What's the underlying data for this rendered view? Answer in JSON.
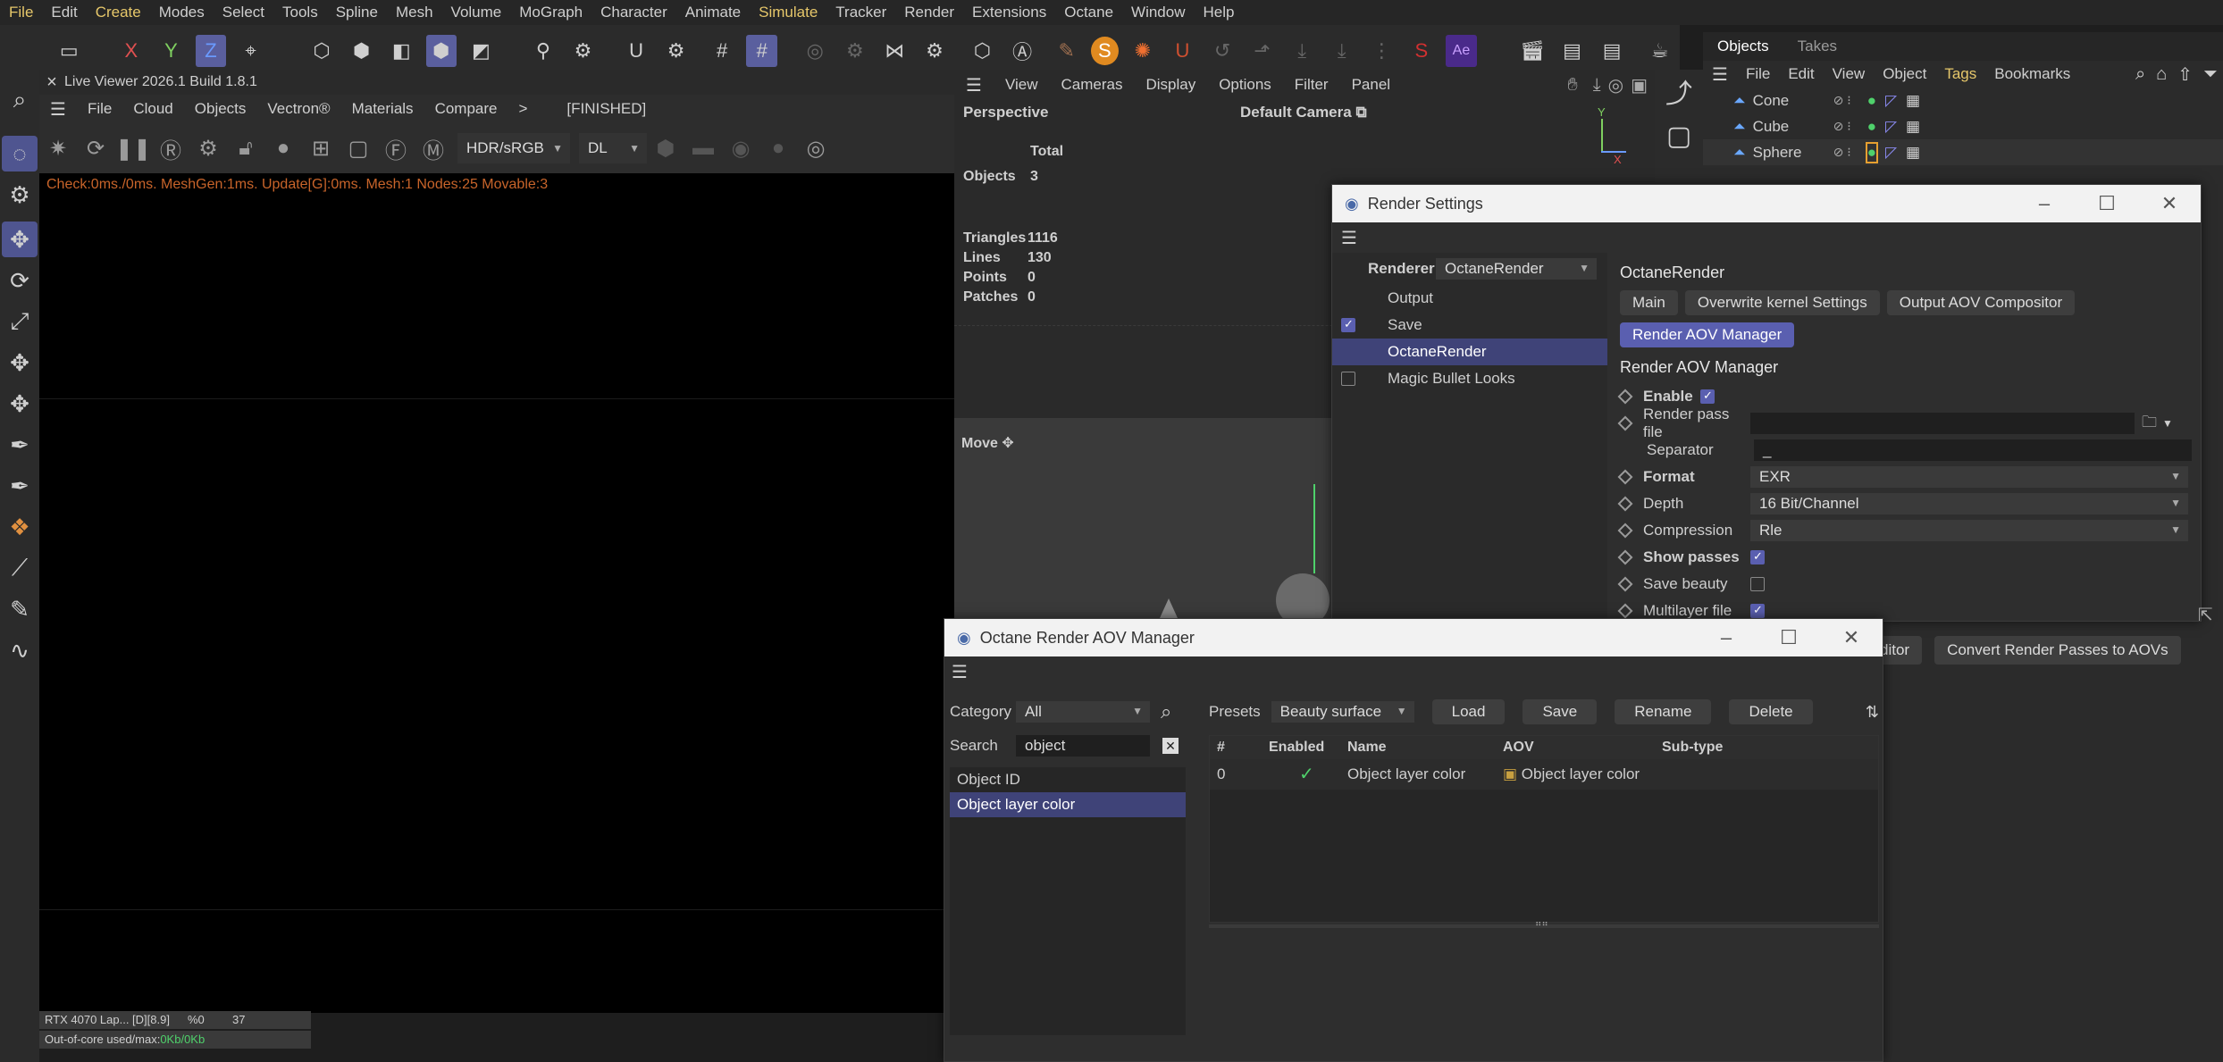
{
  "menubar": [
    "File",
    "Edit",
    "Create",
    "Modes",
    "Select",
    "Tools",
    "Spline",
    "Mesh",
    "Volume",
    "MoGraph",
    "Character",
    "Animate",
    "Simulate",
    "Tracker",
    "Render",
    "Extensions",
    "Octane",
    "Window",
    "Help"
  ],
  "menubar_active": [
    "Create",
    "Simulate"
  ],
  "toolbar_axes": {
    "x": "X",
    "y": "Y",
    "z": "Z"
  },
  "live_viewer": {
    "title": "Live Viewer 2026.1 Build 1.8.1",
    "menu": [
      "File",
      "Cloud",
      "Objects",
      "Vectron®",
      "Materials",
      "Compare",
      ">",
      "[FINISHED]"
    ],
    "color_mode": "HDR/sRGB",
    "kernel": "DL",
    "status": "Check:0ms./0ms. MeshGen:1ms. Update[G]:0ms. Mesh:1 Nodes:25 Movable:3",
    "hud": {
      "gpu": "RTX 4070 Lap... [D][8.9]",
      "pct": "%0",
      "temp": "37",
      "ooc_label": "Out-of-core used/max:",
      "ooc_value": "0Kb/0Kb"
    }
  },
  "viewport": {
    "menu": [
      "View",
      "Cameras",
      "Display",
      "Options",
      "Filter",
      "Panel"
    ],
    "name": "Perspective",
    "camera": "Default Camera",
    "stats": {
      "total_label": "Total",
      "objects_label": "Objects",
      "objects": "3",
      "triangles_label": "Triangles",
      "triangles": "1116",
      "lines_label": "Lines",
      "lines": "130",
      "points_label": "Points",
      "points": "0",
      "patches_label": "Patches",
      "patches": "0"
    },
    "move_label": "Move"
  },
  "objects_panel": {
    "tabs": [
      "Objects",
      "Takes"
    ],
    "menu": [
      "File",
      "Edit",
      "View",
      "Object",
      "Tags",
      "Bookmarks"
    ],
    "items": [
      "Cone",
      "Cube",
      "Sphere"
    ]
  },
  "render_settings": {
    "title": "Render Settings",
    "renderer_label": "Renderer",
    "renderer": "OctaneRender",
    "nav": [
      "Output",
      "Save",
      "OctaneRender",
      "Magic Bullet Looks"
    ],
    "section": "OctaneRender",
    "tabs": [
      "Main",
      "Overwrite kernel Settings",
      "Output AOV Compositor",
      "Render AOV Manager"
    ],
    "heading": "Render AOV Manager",
    "fields": {
      "enable": "Enable",
      "render_pass_file": "Render pass file",
      "separator": "Separator",
      "separator_value": "_",
      "format": "Format",
      "format_value": "EXR",
      "depth": "Depth",
      "depth_value": "16 Bit/Channel",
      "compression": "Compression",
      "compression_value": "Rle",
      "show_passes": "Show passes",
      "save_beauty": "Save beauty",
      "multilayer": "Multilayer file"
    },
    "extra_buttons": [
      "ditor",
      "Convert Render Passes to AOVs"
    ]
  },
  "aov_manager": {
    "title": "Octane Render AOV Manager",
    "category_label": "Category",
    "category": "All",
    "search_label": "Search",
    "search": "object",
    "presets_label": "Presets",
    "preset": "Beauty surface",
    "buttons": [
      "Load",
      "Save",
      "Rename",
      "Delete"
    ],
    "list": [
      "Object ID",
      "Object layer color"
    ],
    "columns": [
      "#",
      "Enabled",
      "Name",
      "AOV",
      "Sub-type"
    ],
    "rows": [
      {
        "index": "0",
        "enabled": "✓",
        "name": "Object layer color",
        "aov": "Object layer color",
        "subtype": ""
      }
    ]
  },
  "colors": {
    "accent": "#5a5fb0",
    "status_orange": "#c8642a",
    "ooc_green": "#4fd16b"
  }
}
